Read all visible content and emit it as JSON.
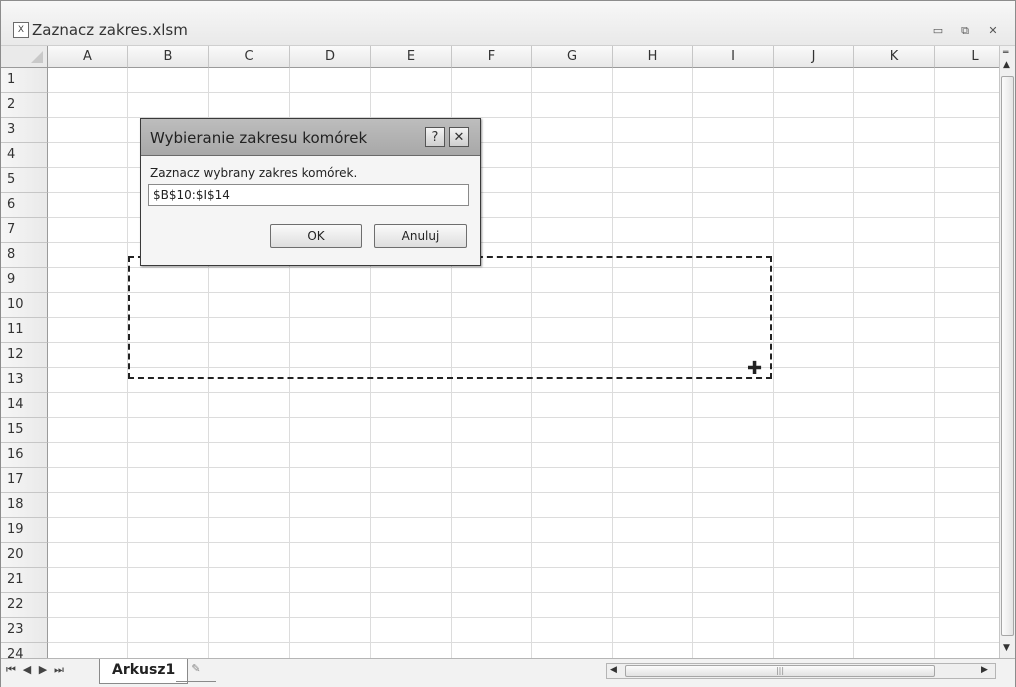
{
  "window": {
    "title": "Zaznacz zakres.xlsm",
    "controls": {
      "minimize": "▭",
      "restore": "⧉",
      "close": "✕"
    }
  },
  "grid": {
    "columns": [
      "A",
      "B",
      "C",
      "D",
      "E",
      "F",
      "G",
      "H",
      "I",
      "J",
      "K",
      "L"
    ],
    "rows": [
      "1",
      "2",
      "3",
      "4",
      "5",
      "6",
      "7",
      "8",
      "9",
      "10",
      "11",
      "12",
      "13",
      "14",
      "15",
      "16",
      "17",
      "18",
      "19",
      "20",
      "21",
      "22",
      "23",
      "24"
    ]
  },
  "dialog": {
    "title": "Wybieranie zakresu komórek",
    "help_label": "?",
    "close_label": "✕",
    "prompt": "Zaznacz wybrany zakres komórek.",
    "input_value": "$B$10:$I$14",
    "ok_label": "OK",
    "cancel_label": "Anuluj"
  },
  "sheets": {
    "active_tab": "Arkusz1",
    "new_tab_icon": "✎",
    "nav": [
      "⏮",
      "◀",
      "▶",
      "⏭"
    ]
  },
  "hscroll": {
    "grip": "|||"
  },
  "colors": {
    "marquee": "#222222",
    "dialog_title": "#a8a8a8"
  }
}
